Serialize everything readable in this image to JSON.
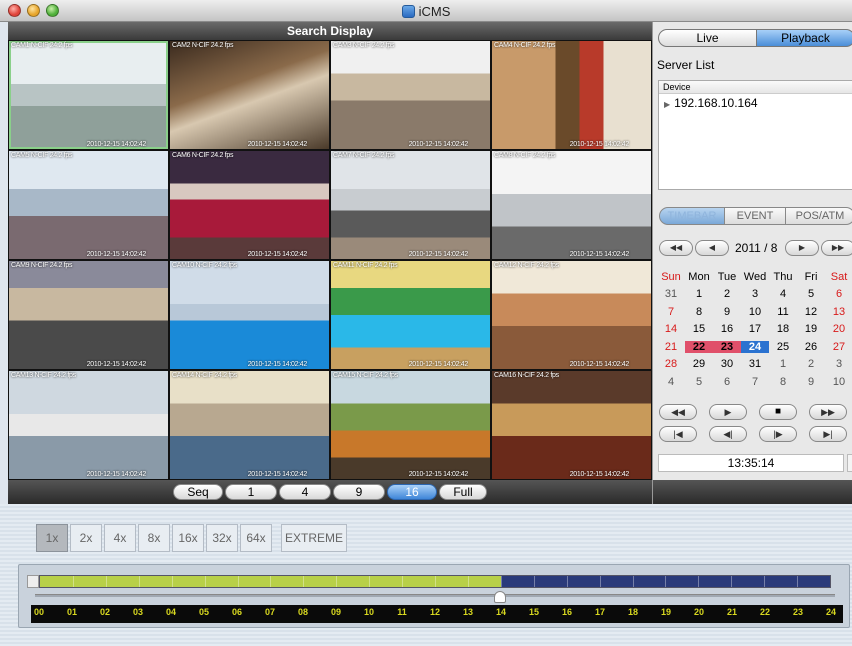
{
  "window": {
    "title": "iCMS"
  },
  "display": {
    "title": "Search Display",
    "cameras": [
      {
        "label": "CAM1 N-CIF 24.2 fps",
        "time": "2010-12-15  14:02:42",
        "scene": "hospital"
      },
      {
        "label": "CAM2 N-CIF 24.2 fps",
        "time": "2010-12-15  14:02:42",
        "scene": "atrium"
      },
      {
        "label": "CAM3 N-CIF 24.2 fps",
        "time": "2010-12-15  14:02:42",
        "scene": "mall"
      },
      {
        "label": "CAM4 N-CIF 24.2 fps",
        "time": "2010-12-15  14:02:42",
        "scene": "library"
      },
      {
        "label": "CAM5 N-CIF 24.2 fps",
        "time": "2010-12-15  14:02:42",
        "scene": "office"
      },
      {
        "label": "CAM6 N-CIF 24.2 fps",
        "time": "2010-12-15  14:02:42",
        "scene": "theater"
      },
      {
        "label": "CAM7 N-CIF 24.2 fps",
        "time": "2010-12-15  14:02:42",
        "scene": "lobby"
      },
      {
        "label": "CAM8 N-CIF 24.2 fps",
        "time": "2010-12-15  14:02:42",
        "scene": "gym"
      },
      {
        "label": "CAM9 N-CIF 24.2 fps",
        "time": "2010-12-15  14:02:42",
        "scene": "escalator"
      },
      {
        "label": "CAM10 N-CIF 24.2 fps",
        "time": "2010-12-15  14:02:42",
        "scene": "pool"
      },
      {
        "label": "CAM11 N-CIF 24.2 fps",
        "time": "2010-12-15  14:02:42",
        "scene": "waterpark"
      },
      {
        "label": "CAM12 N-CIF 24.2 fps",
        "time": "2010-12-15  14:02:42",
        "scene": "hall"
      },
      {
        "label": "CAM13 N-CIF 24.2 fps",
        "time": "2010-12-15  14:02:42",
        "scene": "cafeteria"
      },
      {
        "label": "CAM14 N-CIF 24.2 fps",
        "time": "2010-12-15  14:02:42",
        "scene": "reception"
      },
      {
        "label": "CAM15 N-CIF 24.2 fps",
        "time": "2010-12-15  14:02:42",
        "scene": "garden"
      },
      {
        "label": "CAM16 N-CIF 24.2 fps",
        "time": "2010-12-15  14:02:42",
        "scene": "church"
      }
    ],
    "selected_camera": 1
  },
  "modebar": {
    "buttons": [
      "Seq",
      "1",
      "4",
      "9",
      "16",
      "Full"
    ],
    "active": "16"
  },
  "rightpanel": {
    "mode_live": "Live",
    "mode_playback": "Playback",
    "server_list_label": "Server List",
    "device_header": "Device",
    "device": "192.168.10.164",
    "tabs": {
      "timebar": "TIMEBAR",
      "event": "EVENT",
      "pos": "POS/ATM"
    },
    "month": "2011 / 8",
    "weekdays": [
      "Sun",
      "Mon",
      "Tue",
      "Wed",
      "Thu",
      "Fri",
      "Sat"
    ],
    "weeks": [
      [
        "31",
        "1",
        "2",
        "3",
        "4",
        "5",
        "6"
      ],
      [
        "7",
        "8",
        "9",
        "10",
        "11",
        "12",
        "13"
      ],
      [
        "14",
        "15",
        "16",
        "17",
        "18",
        "19",
        "20"
      ],
      [
        "21",
        "22",
        "23",
        "24",
        "25",
        "26",
        "27"
      ],
      [
        "28",
        "29",
        "30",
        "31",
        "1",
        "2",
        "3"
      ],
      [
        "4",
        "5",
        "6",
        "7",
        "8",
        "9",
        "10"
      ]
    ],
    "highlighted_days": [
      "22",
      "23"
    ],
    "selected_day": "24",
    "time": "13:35:14"
  },
  "speeds": {
    "options": [
      "1x",
      "2x",
      "4x",
      "8x",
      "16x",
      "32x",
      "64x",
      "EXTREME"
    ],
    "active": "1x"
  },
  "timeline": {
    "hours": [
      "00",
      "01",
      "02",
      "03",
      "04",
      "05",
      "06",
      "07",
      "08",
      "09",
      "10",
      "11",
      "12",
      "13",
      "14",
      "15",
      "16",
      "17",
      "18",
      "19",
      "20",
      "21",
      "22",
      "23",
      "24"
    ],
    "recorded_until_hour": 14,
    "cursor_hour": 14,
    "colors": {
      "recorded": "#b8d048",
      "empty": "#2a3a7a",
      "hour_text": "#d8d820"
    }
  }
}
